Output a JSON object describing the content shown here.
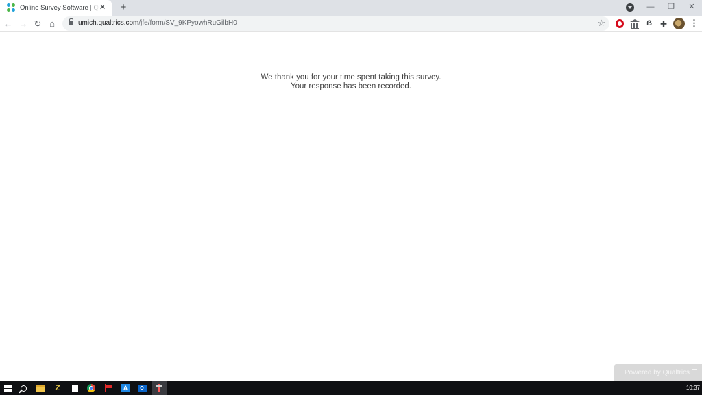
{
  "browser": {
    "tab": {
      "title": "Online Survey Software | Qualtrics Survey Solutions",
      "favicon": "qualtrics-favicon-icon",
      "close_glyph": "✕"
    },
    "new_tab_glyph": "+",
    "window_controls": {
      "minimize": "—",
      "restore": "❐",
      "close": "✕"
    },
    "toolbar": {
      "back_glyph": "←",
      "forward_glyph": "→",
      "reload_glyph": "↻",
      "home_glyph": "⌂",
      "url_host": "umich.qualtrics.com",
      "url_path": "/jfe/form/SV_9KPyowhRuGilbH0",
      "star_glyph": "☆",
      "ext_b_glyph": "ẞ",
      "puzzle_glyph": "✚",
      "menu_glyph": "⋮"
    }
  },
  "page": {
    "message_line1": "We thank you for your time spent taking this survey.",
    "message_line2": "Your response has been recorded.",
    "powered_by": "Powered by Qualtrics",
    "powered_bg": "#d9d9d9"
  },
  "taskbar": {
    "clock": "10:37",
    "glyph_app": "Z",
    "a_app": "A",
    "outlook_app": "O"
  }
}
